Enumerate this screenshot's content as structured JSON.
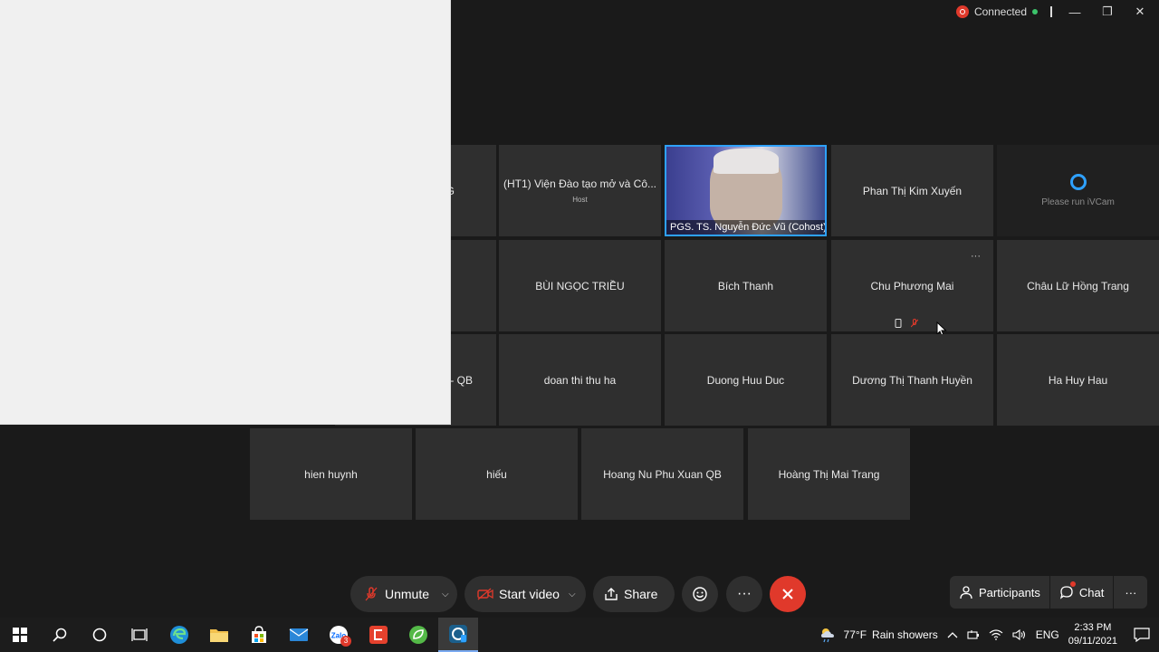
{
  "window": {
    "connection_status": "Connected",
    "minimize": "—",
    "restore": "❐",
    "close": "✕"
  },
  "tiles": [
    {
      "name": "G",
      "sub": ""
    },
    {
      "name": "(HT1) Viện Đào tạo mở và Cô...",
      "sub": "Host"
    },
    {
      "name": "PGS. TS. Nguyễn Đức Vũ  (Cohost)",
      "sub": ""
    },
    {
      "name": "Phan Thị Kim Xuyến",
      "sub": ""
    },
    {
      "name": "Please run iVCam",
      "sub": ""
    },
    {
      "name": "",
      "sub": ""
    },
    {
      "name": "BÙI NGỌC TRIỀU",
      "sub": ""
    },
    {
      "name": "Bích Thanh",
      "sub": ""
    },
    {
      "name": "Chu Phương Mai",
      "sub": ""
    },
    {
      "name": "Châu Lữ Hồng Trang",
      "sub": ""
    },
    {
      "name": "- QB",
      "sub": ""
    },
    {
      "name": "doan thi thu ha",
      "sub": ""
    },
    {
      "name": "Duong Huu Duc",
      "sub": ""
    },
    {
      "name": "Dương Thị Thanh Huyền",
      "sub": ""
    },
    {
      "name": "Ha Huy Hau",
      "sub": ""
    },
    {
      "name": "hien huynh",
      "sub": ""
    },
    {
      "name": "hiếu",
      "sub": ""
    },
    {
      "name": "Hoang Nu Phu Xuan QB",
      "sub": ""
    },
    {
      "name": "Hoàng Thị Mai Trang",
      "sub": ""
    }
  ],
  "tile_menu": "···",
  "controls": {
    "unmute": "Unmute",
    "start_video": "Start video",
    "share": "Share",
    "more": "···",
    "participants": "Participants",
    "chat": "Chat",
    "more_right": "···"
  },
  "taskbar": {
    "weather": "77°F",
    "weather_desc": "Rain showers",
    "language": "ENG",
    "time": "2:33 PM",
    "date": "09/11/2021",
    "mail_badge": "3"
  },
  "colors": {
    "accent": "#2ea1ff",
    "end_call": "#e0392b",
    "tile_bg": "#2f2f2f",
    "background": "#1a1a1a"
  }
}
